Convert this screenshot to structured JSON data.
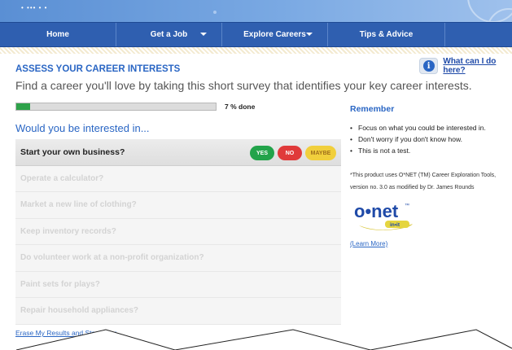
{
  "nav": {
    "items": [
      {
        "label": "Home"
      },
      {
        "label": "Get a Job"
      },
      {
        "label": "Explore Careers"
      },
      {
        "label": "Tips & Advice"
      }
    ]
  },
  "header": {
    "title": "ASSESS YOUR CAREER INTERESTS",
    "help_link": "What can I do here?",
    "intro": "Find a career you'll love by taking this short survey that identifies your key career interests."
  },
  "progress": {
    "percent": 7,
    "label": "7 % done"
  },
  "survey": {
    "title": "Would you be interested in...",
    "questions": [
      {
        "text": "Start your own business?"
      },
      {
        "text": "Operate a calculator?"
      },
      {
        "text": "Market a new line of clothing?"
      },
      {
        "text": "Keep inventory records?"
      },
      {
        "text": "Do volunteer work at a non-profit organization?"
      },
      {
        "text": "Paint sets for plays?"
      },
      {
        "text": "Repair household appliances?"
      }
    ],
    "answers": {
      "yes": "YES",
      "no": "NO",
      "maybe": "MAYBE"
    },
    "erase_link": "Erase My Results and Start Over"
  },
  "sidebar": {
    "title": "Remember",
    "tips": [
      "Focus on what you could be interested in.",
      "Don't worry if you don't know how.",
      "This is not a test."
    ],
    "fine_print": "*This product uses O*NET (TM) Career Exploration Tools, version no. 3.0 as modified by Dr. James Rounds",
    "logo": {
      "text": "o•net",
      "tm": "™",
      "sub": "in•it"
    },
    "learn_more": "(Learn More)"
  },
  "colors": {
    "nav_bg": "#2f5fb0",
    "accent": "#2a66c4",
    "progress": "#2ea24a",
    "yes": "#22a34a",
    "no": "#e03a3a",
    "maybe": "#f1cf3c"
  }
}
